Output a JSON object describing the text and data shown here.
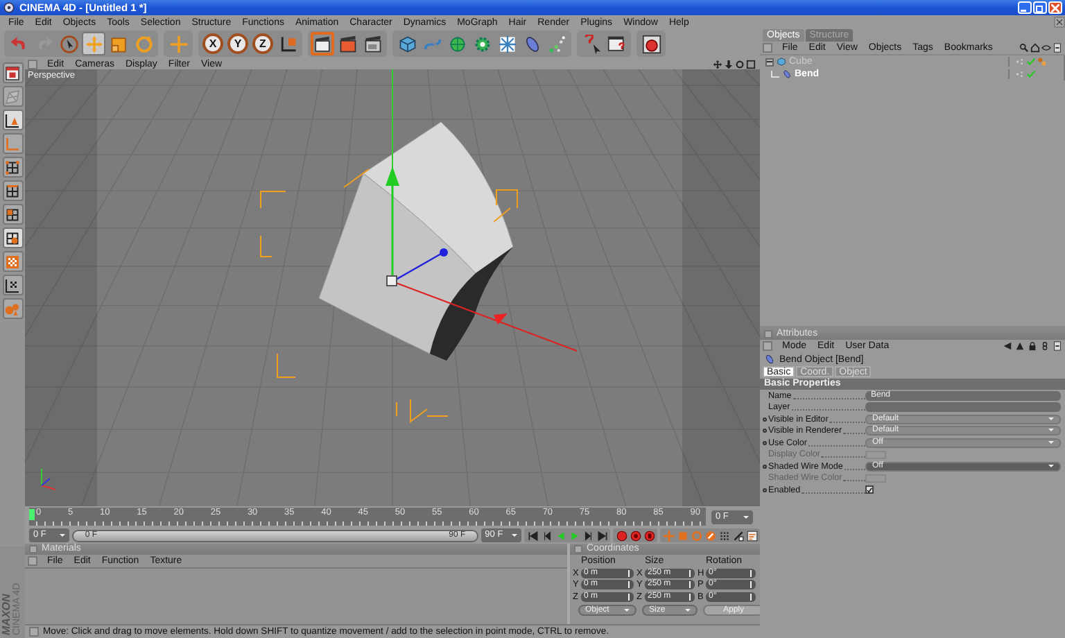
{
  "window": {
    "title": "CINEMA 4D - [Untitled 1 *]"
  },
  "menu_bar": [
    "File",
    "Edit",
    "Objects",
    "Tools",
    "Selection",
    "Structure",
    "Functions",
    "Animation",
    "Character",
    "Dynamics",
    "MoGraph",
    "Hair",
    "Render",
    "Plugins",
    "Window",
    "Help"
  ],
  "toolbar": {
    "axis_buttons": [
      "X",
      "Y",
      "Z"
    ]
  },
  "viewport": {
    "menu": [
      "Edit",
      "Cameras",
      "Display",
      "Filter",
      "View"
    ],
    "camera": "Perspective"
  },
  "timeline": {
    "ruler": [
      "0",
      "5",
      "10",
      "15",
      "20",
      "25",
      "30",
      "35",
      "40",
      "45",
      "50",
      "55",
      "60",
      "65",
      "70",
      "75",
      "80",
      "85",
      "90"
    ],
    "current_frame": "0 F",
    "start_field": "0 F",
    "range_slider": {
      "start": "0 F",
      "end": "90 F",
      "level": 1
    },
    "end_field": "90 F",
    "level": 0
  },
  "objects": {
    "tabs": [
      {
        "label": "Objects",
        "selected": true
      },
      {
        "label": "Structure",
        "selected": false
      }
    ],
    "menu": [
      "File",
      "Edit",
      "View",
      "Objects",
      "Tags",
      "Bookmarks"
    ],
    "tree": [
      {
        "name": "Cube",
        "selected": false,
        "expanded": true,
        "children": [
          {
            "name": "Bend",
            "selected": true
          }
        ]
      }
    ]
  },
  "attributes": {
    "title": "Attributes",
    "menu": [
      "Mode",
      "Edit",
      "User Data"
    ],
    "object": "Bend Object [Bend]",
    "tabs": [
      {
        "label": "Basic",
        "selected": true
      },
      {
        "label": "Coord.",
        "selected": false
      },
      {
        "label": "Object",
        "selected": false
      }
    ],
    "section": "Basic Properties",
    "fields": [
      {
        "label": "Name",
        "kind": "text",
        "value": "Bend",
        "animatable": false,
        "disabled": false
      },
      {
        "label": "Layer",
        "kind": "layer",
        "animatable": false,
        "disabled": false
      },
      {
        "label": "Visible in Editor",
        "kind": "dropdown",
        "value": "Default",
        "animatable": true,
        "disabled": false
      },
      {
        "label": "Visible in Renderer",
        "kind": "dropdown",
        "value": "Default",
        "animatable": true,
        "disabled": false
      },
      {
        "label": "Use Color",
        "kind": "dropdown",
        "value": "Off",
        "animatable": true,
        "disabled": false
      },
      {
        "label": "Display Color",
        "kind": "color",
        "animatable": false,
        "disabled": true
      },
      {
        "label": "Shaded Wire Mode",
        "kind": "dropdown",
        "value": "Off",
        "animatable": true,
        "disabled": false
      },
      {
        "label": "Shaded Wire Color",
        "kind": "color",
        "animatable": false,
        "disabled": true
      },
      {
        "label": "Enabled",
        "kind": "checkbox",
        "checked": true,
        "animatable": true,
        "disabled": false
      }
    ]
  },
  "materials": {
    "title": "Materials",
    "menu": [
      "File",
      "Edit",
      "Function",
      "Texture"
    ]
  },
  "coordinates": {
    "title": "Coordinates",
    "headers": [
      "Position",
      "Size",
      "Rotation"
    ],
    "rows": [
      {
        "cells": [
          {
            "axis": "X",
            "value": "0 m"
          },
          {
            "axis": "X",
            "value": "250 m"
          },
          {
            "axis": "H",
            "value": "0°"
          }
        ]
      },
      {
        "cells": [
          {
            "axis": "Y",
            "value": "0 m"
          },
          {
            "axis": "Y",
            "value": "250 m"
          },
          {
            "axis": "P",
            "value": "0°"
          }
        ]
      },
      {
        "cells": [
          {
            "axis": "Z",
            "value": "0 m"
          },
          {
            "axis": "Z",
            "value": "250 m"
          },
          {
            "axis": "B",
            "value": "0°"
          }
        ]
      }
    ],
    "dropdowns": [
      "Object",
      "Size"
    ],
    "apply": "Apply"
  },
  "logo": [
    "MAXON",
    "CINEMA 4D"
  ],
  "status_bar": "Move: Click and drag to move elements. Hold down SHIFT to quantize movement / add to the selection in point mode, CTRL to remove."
}
